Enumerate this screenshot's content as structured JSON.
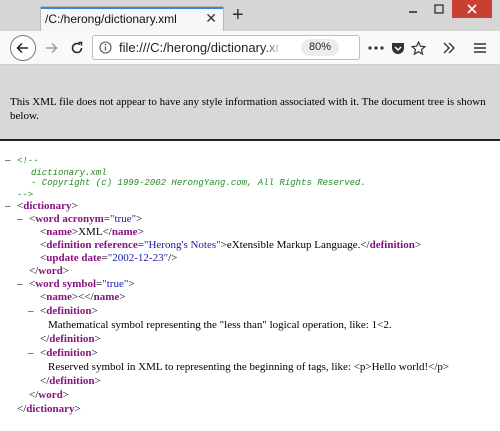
{
  "browser": {
    "tab_title": "/C:/herong/dictionary.xml",
    "new_tab_symbol": "+",
    "url": "file:///C:/herong/dictionary.xm",
    "zoom": "80%",
    "colors": {
      "accent": "#3c82d6",
      "close": "#c84031"
    }
  },
  "banner": {
    "text": "This XML file does not appear to have any style information associated with it. The document tree is shown below."
  },
  "xml": {
    "comment_open": "<!--",
    "comment_line1": "dictionary.xml",
    "comment_line2": "- Copyright (c) 1999-2002 HerongYang.com, All Rights Reserved.",
    "comment_close": "-->",
    "root_tag": "dictionary",
    "word_tag": "word",
    "attr_acronym": "acronym",
    "attr_acronym_value": "\"true\"",
    "name_tag": "name",
    "name1_text": "XML",
    "definition_tag": "definition",
    "attr_reference": "reference",
    "attr_reference_value": "\"Herong's Notes\"",
    "definition1_text": "eXtensible Markup Language.",
    "update_tag": "update",
    "attr_date": "date",
    "attr_date_value": "\"2002-12-23\"",
    "attr_symbol": "symbol",
    "attr_symbol_value": "\"true\"",
    "name2_text": "<",
    "definition2_text": "Mathematical symbol representing the \"less than\" logical operation, like: 1<2.",
    "definition3_text": "Reserved symbol in XML to representing the beginning of tags, like: <p>Hello world!</p>"
  }
}
